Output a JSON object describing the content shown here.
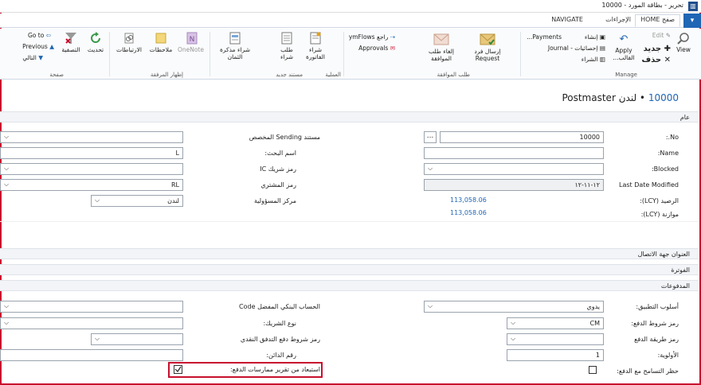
{
  "window": {
    "title": "تحرير - بطاقة المورد - 10000"
  },
  "tabs": {
    "file": "▾",
    "home": "HOME",
    "home_ar": "صفح",
    "actions": "الإجراءات",
    "navigate": "NAVIGATE"
  },
  "ribbon": {
    "view": "View",
    "edit": "Edit",
    "new": "جديد",
    "delete": "حذف",
    "manage_label": "Manage",
    "apply": "Apply",
    "apply_template": "القالب...",
    "create": "إنشاء",
    "statistics": "إحصائيات - Journal",
    "purchase": "الشراء",
    "payments": "Payments...",
    "send_request": "إرسال فرد Request",
    "cancel_request": "إلغاء طلب الموافقة",
    "approval_group": "طلب الموافقة",
    "flows": "راجع ymFlows",
    "approvals": "Approvals",
    "purchase_invoice": "شراء الفاتورة",
    "purchase_order": "طلب شراء",
    "process_group": "العملية",
    "price_memo": "شراء مذكرة الثمان",
    "new_doc_group": "مستند جديد",
    "onenote": "OneNote",
    "notes": "ملاحظات",
    "links": "الارتباطات",
    "show_group": "إظهار المرفقة",
    "refresh": "تحديث",
    "clear_filter": "التصفية",
    "go_to": "Go to",
    "previous": "Previous",
    "next": "التالي",
    "page_group": "صفحة"
  },
  "page": {
    "number": "10000",
    "name": "لندن Postmaster"
  },
  "sections": {
    "general": "عام",
    "contact": "العنوان جهة الاتصال",
    "invoicing": "الفوترة",
    "payments": "المدفوعات"
  },
  "general": {
    "no_label": "No.:",
    "no_value": "10000",
    "name_label": "Name:",
    "blocked_label": "Blocked:",
    "last_modified_label": "Last Date Modified",
    "last_modified_value": "١٢-١١-١٢",
    "balance_label": "الرصيد (LCY):",
    "balance_value": "113,058.06",
    "balance_due_label": "موازنة (LCY):",
    "balance_due_value": "113,058.06",
    "doc_sending_label": "مستند Sending المخصص",
    "search_name_label": "اسم البحث:",
    "search_name_value": "L",
    "ic_partner_label": "رمز شريك IC",
    "purchaser_label": "رمز المشتري",
    "purchaser_value": "RL",
    "resp_center_label": "مركز المسؤولية",
    "resp_center_value": "لندن"
  },
  "payments": {
    "application_label": "أسلوب التطبيق:",
    "application_value": "يدوي",
    "terms_label": "رمز شروط الدفع:",
    "terms_value": "CM",
    "method_label": "رمز طريقة الدفع",
    "priority_label": "الأولوية:",
    "priority_value": "1",
    "block_tolerance_label": "حظر التسامح مع الدفع:",
    "bank_label": "الحساب البنكي المفضل Code",
    "partner_type_label": "نوع الشريك:",
    "cash_flow_label": "رمز شروط دفع التدفق النقدي",
    "creditor_label": "رقم الدائن:",
    "exclude_label": "استبعاد من تقرير ممارسات الدفع:"
  }
}
